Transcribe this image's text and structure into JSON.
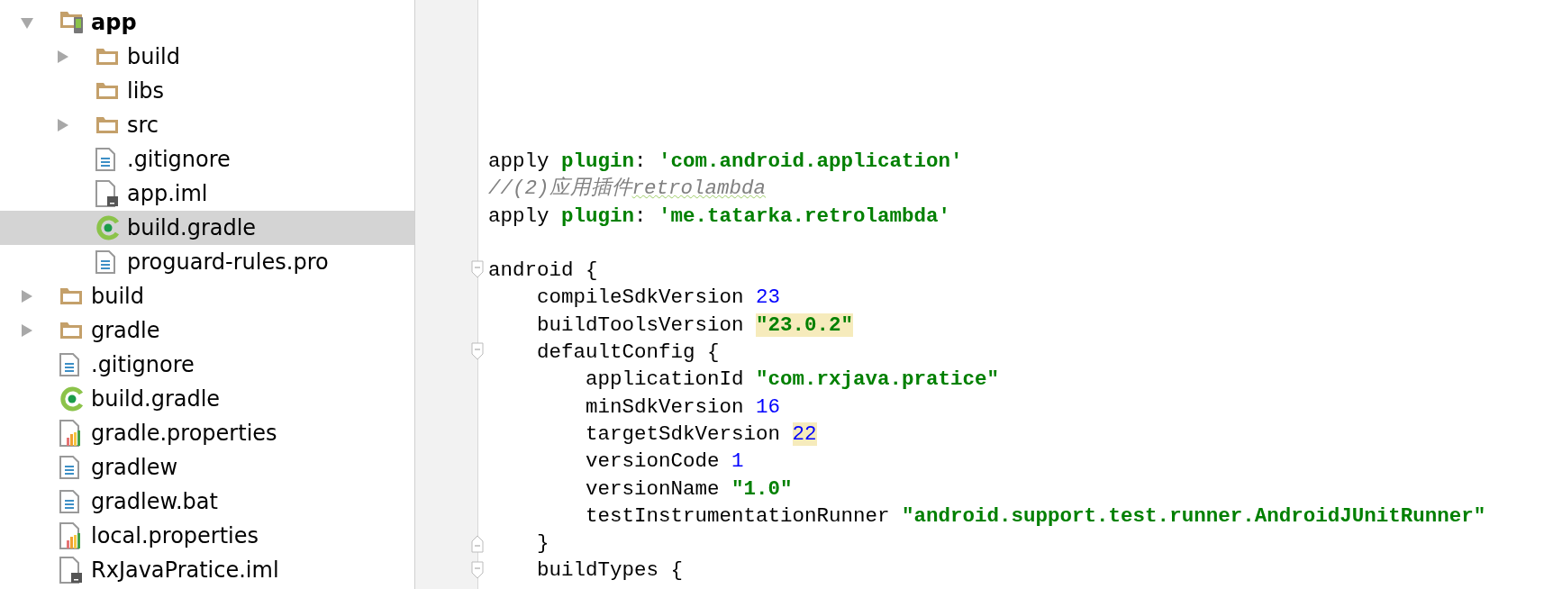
{
  "project_tree": [
    {
      "label": "app",
      "kind": "module",
      "expanded": true,
      "selected": false,
      "children": [
        {
          "label": "build",
          "kind": "folder",
          "expanded": false,
          "selected": false
        },
        {
          "label": "libs",
          "kind": "folder",
          "selected": false
        },
        {
          "label": "src",
          "kind": "folder",
          "expanded": false,
          "selected": false
        },
        {
          "label": ".gitignore",
          "kind": "text",
          "selected": false
        },
        {
          "label": "app.iml",
          "kind": "iml",
          "selected": false
        },
        {
          "label": "build.gradle",
          "kind": "gradle",
          "selected": true
        },
        {
          "label": "proguard-rules.pro",
          "kind": "text",
          "selected": false
        }
      ]
    },
    {
      "label": "build",
      "kind": "folder",
      "expanded": false,
      "selected": false
    },
    {
      "label": "gradle",
      "kind": "folder",
      "expanded": false,
      "selected": false
    },
    {
      "label": ".gitignore",
      "kind": "text",
      "selected": false
    },
    {
      "label": "build.gradle",
      "kind": "gradle",
      "selected": false
    },
    {
      "label": "gradle.properties",
      "kind": "properties",
      "selected": false
    },
    {
      "label": "gradlew",
      "kind": "text",
      "selected": false
    },
    {
      "label": "gradlew.bat",
      "kind": "text",
      "selected": false
    },
    {
      "label": "local.properties",
      "kind": "properties",
      "selected": false
    },
    {
      "label": "RxJavaPratice.iml",
      "kind": "iml",
      "selected": false
    }
  ],
  "editor": {
    "lines": [
      {
        "kind": "plain",
        "segments": [
          {
            "kind": "plain",
            "text": "apply "
          },
          {
            "kind": "keyword",
            "text": "plugin"
          },
          {
            "kind": "plain",
            "text": ": "
          },
          {
            "kind": "string",
            "text": "'com.android.application'"
          }
        ]
      },
      {
        "kind": "plain",
        "segments": [
          {
            "kind": "comment",
            "text": "//(2)应用插件"
          },
          {
            "kind": "comment",
            "text": "retrolambda",
            "typo": true
          }
        ]
      },
      {
        "kind": "plain",
        "segments": [
          {
            "kind": "plain",
            "text": "apply "
          },
          {
            "kind": "keyword",
            "text": "plugin"
          },
          {
            "kind": "plain",
            "text": ": "
          },
          {
            "kind": "string",
            "text": "'me.tatarka.retrolambda'"
          }
        ]
      },
      {
        "kind": "plain"
      },
      {
        "kind": "fold_start",
        "segments": [
          {
            "kind": "plain",
            "text": "android {"
          }
        ]
      },
      {
        "kind": "plain",
        "segments": [
          {
            "kind": "plain",
            "text": "    compileSdkVersion "
          },
          {
            "kind": "number",
            "text": "23"
          }
        ]
      },
      {
        "kind": "plain",
        "segments": [
          {
            "kind": "plain",
            "text": "    buildToolsVersion "
          },
          {
            "kind": "string",
            "text": "\"23.0.2\"",
            "warning": true
          }
        ]
      },
      {
        "kind": "fold_start",
        "segments": [
          {
            "kind": "plain",
            "text": "    defaultConfig {"
          }
        ]
      },
      {
        "kind": "plain",
        "segments": [
          {
            "kind": "plain",
            "text": "        applicationId "
          },
          {
            "kind": "string",
            "text": "\"com.rxjava.pratice\""
          }
        ]
      },
      {
        "kind": "plain",
        "segments": [
          {
            "kind": "plain",
            "text": "        minSdkVersion "
          },
          {
            "kind": "number",
            "text": "16"
          }
        ]
      },
      {
        "kind": "plain",
        "segments": [
          {
            "kind": "plain",
            "text": "        targetSdkVersion "
          },
          {
            "kind": "number",
            "text": "22",
            "warning": true
          }
        ]
      },
      {
        "kind": "plain",
        "segments": [
          {
            "kind": "plain",
            "text": "        versionCode "
          },
          {
            "kind": "number",
            "text": "1"
          }
        ]
      },
      {
        "kind": "plain",
        "segments": [
          {
            "kind": "plain",
            "text": "        versionName "
          },
          {
            "kind": "string",
            "text": "\"1.0\""
          }
        ]
      },
      {
        "kind": "plain",
        "segments": [
          {
            "kind": "plain",
            "text": "        testInstrumentationRunner "
          },
          {
            "kind": "string",
            "text": "\"android.support.test.runner.AndroidJUnitRunner\""
          }
        ]
      },
      {
        "kind": "fold_end",
        "segments": [
          {
            "kind": "plain",
            "text": "    }"
          }
        ]
      },
      {
        "kind": "fold_start",
        "segments": [
          {
            "kind": "plain",
            "text": "    buildTypes {"
          }
        ]
      }
    ]
  }
}
